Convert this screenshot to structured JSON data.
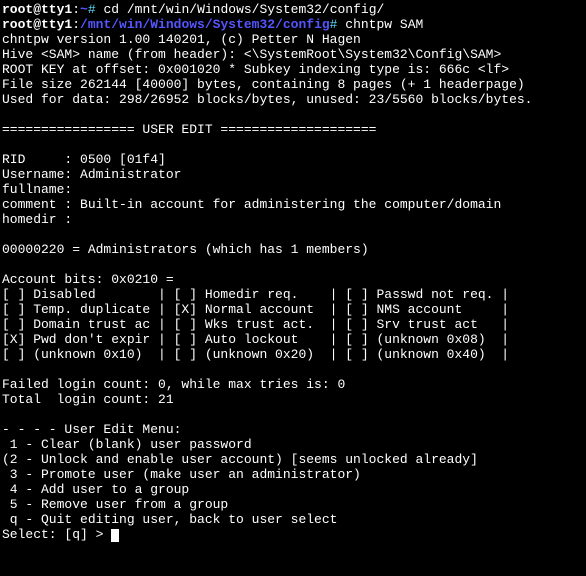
{
  "prompts": [
    {
      "user_host": "root@tty1",
      "path": "~",
      "command": "cd /mnt/win/Windows/System32/config/"
    },
    {
      "user_host": "root@tty1",
      "path": "/mnt/win/Windows/System32/config",
      "command": "chntpw SAM"
    }
  ],
  "header_lines": [
    "chntpw version 1.00 140201, (c) Petter N Hagen",
    "Hive <SAM> name (from header): <\\SystemRoot\\System32\\Config\\SAM>",
    "ROOT KEY at offset: 0x001020 * Subkey indexing type is: 666c <lf>",
    "File size 262144 [40000] bytes, containing 8 pages (+ 1 headerpage)",
    "Used for data: 298/26952 blocks/bytes, unused: 23/5560 blocks/bytes."
  ],
  "blank1": "",
  "section_title": "================= USER EDIT ====================",
  "blank2": "",
  "user_info": [
    "RID     : 0500 [01f4]",
    "Username: Administrator",
    "fullname:",
    "comment : Built-in account for administering the computer/domain",
    "homedir :"
  ],
  "blank3": "",
  "group_line": "00000220 = Administrators (which has 1 members)",
  "blank4": "",
  "account_bits_header": "Account bits: 0x0210 =",
  "bit_rows": [
    "[ ] Disabled        | [ ] Homedir req.    | [ ] Passwd not req. |",
    "[ ] Temp. duplicate | [X] Normal account  | [ ] NMS account     |",
    "[ ] Domain trust ac | [ ] Wks trust act.  | [ ] Srv trust act   |",
    "[X] Pwd don't expir | [ ] Auto lockout    | [ ] (unknown 0x08)  |",
    "[ ] (unknown 0x10)  | [ ] (unknown 0x20)  | [ ] (unknown 0x40)  |"
  ],
  "blank5": "",
  "login_counts": [
    "Failed login count: 0, while max tries is: 0",
    "Total  login count: 21"
  ],
  "blank6": "",
  "menu_header": "- - - - User Edit Menu:",
  "menu_items": [
    " 1 - Clear (blank) user password",
    "(2 - Unlock and enable user account) [seems unlocked already]",
    " 3 - Promote user (make user an administrator)",
    " 4 - Add user to a group",
    " 5 - Remove user from a group",
    " q - Quit editing user, back to user select"
  ],
  "select_prompt": "Select: [q] > "
}
